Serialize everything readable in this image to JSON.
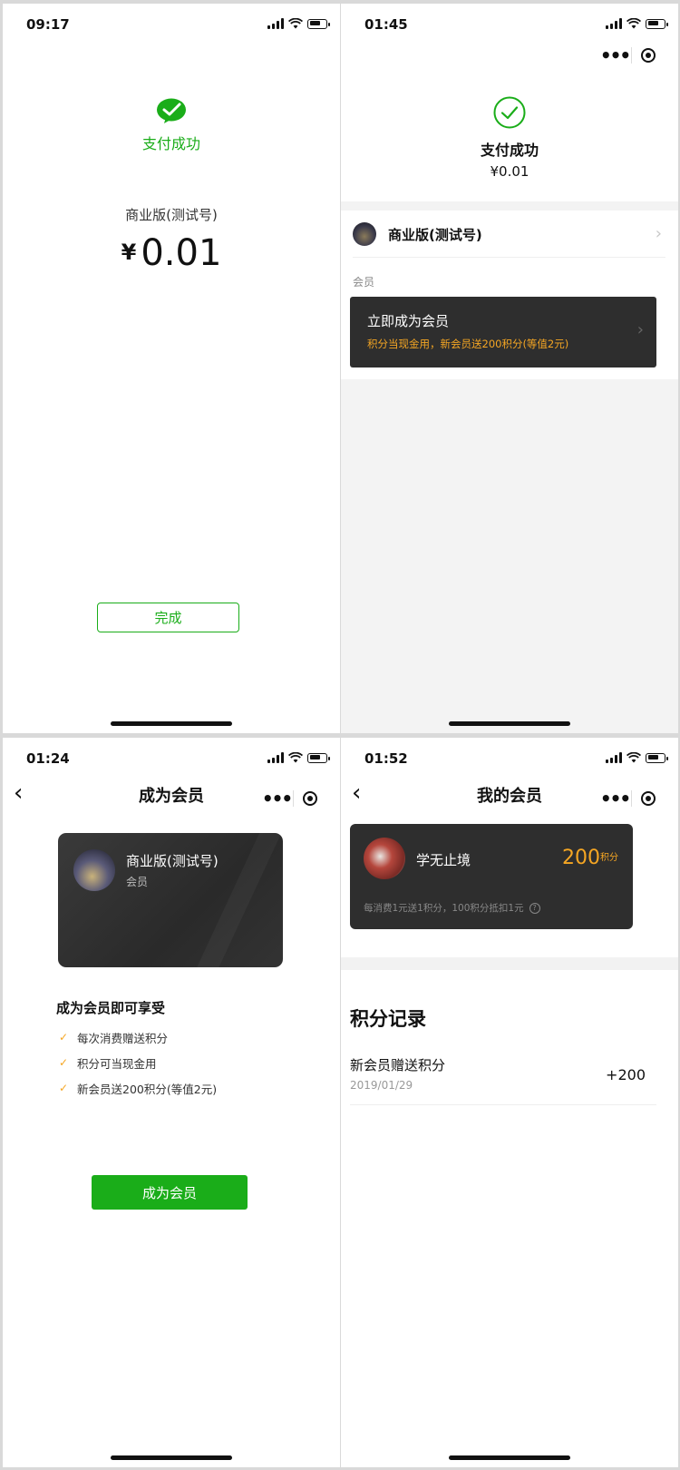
{
  "screens": [
    {
      "time": "09:17",
      "icon": "wechat-pay-icon",
      "status_text": "支付成功",
      "merchant": "商业版(测试号)",
      "currency": "¥",
      "amount": "0.01",
      "done_label": "完成"
    },
    {
      "time": "01:45",
      "icon": "check-circle-icon",
      "status_text": "支付成功",
      "amount": "¥0.01",
      "merchant": "商业版(测试号)",
      "section_label": "会员",
      "member_card": {
        "title": "立即成为会员",
        "subtitle": "积分当现金用，新会员送200积分(等值2元)"
      }
    },
    {
      "time": "01:24",
      "title": "成为会员",
      "card": {
        "name": "商业版(测试号)",
        "sub": "会员"
      },
      "benefits_title": "成为会员即可享受",
      "benefits": [
        "每次消费赠送积分",
        "积分可当现金用",
        "新会员送200积分(等值2元)"
      ],
      "join_label": "成为会员"
    },
    {
      "time": "01:52",
      "title": "我的会员",
      "card": {
        "user": "学无止境",
        "points": "200",
        "points_unit": "积分",
        "rule": "每消费1元送1积分，100积分抵扣1元"
      },
      "records_title": "积分记录",
      "records": [
        {
          "label": "新会员赠送积分",
          "date": "2019/01/29",
          "value": "+200"
        }
      ]
    }
  ],
  "colors": {
    "brand_green": "#1aad19",
    "accent_gold": "#f5a623",
    "card_dark": "#2e2e2e"
  }
}
